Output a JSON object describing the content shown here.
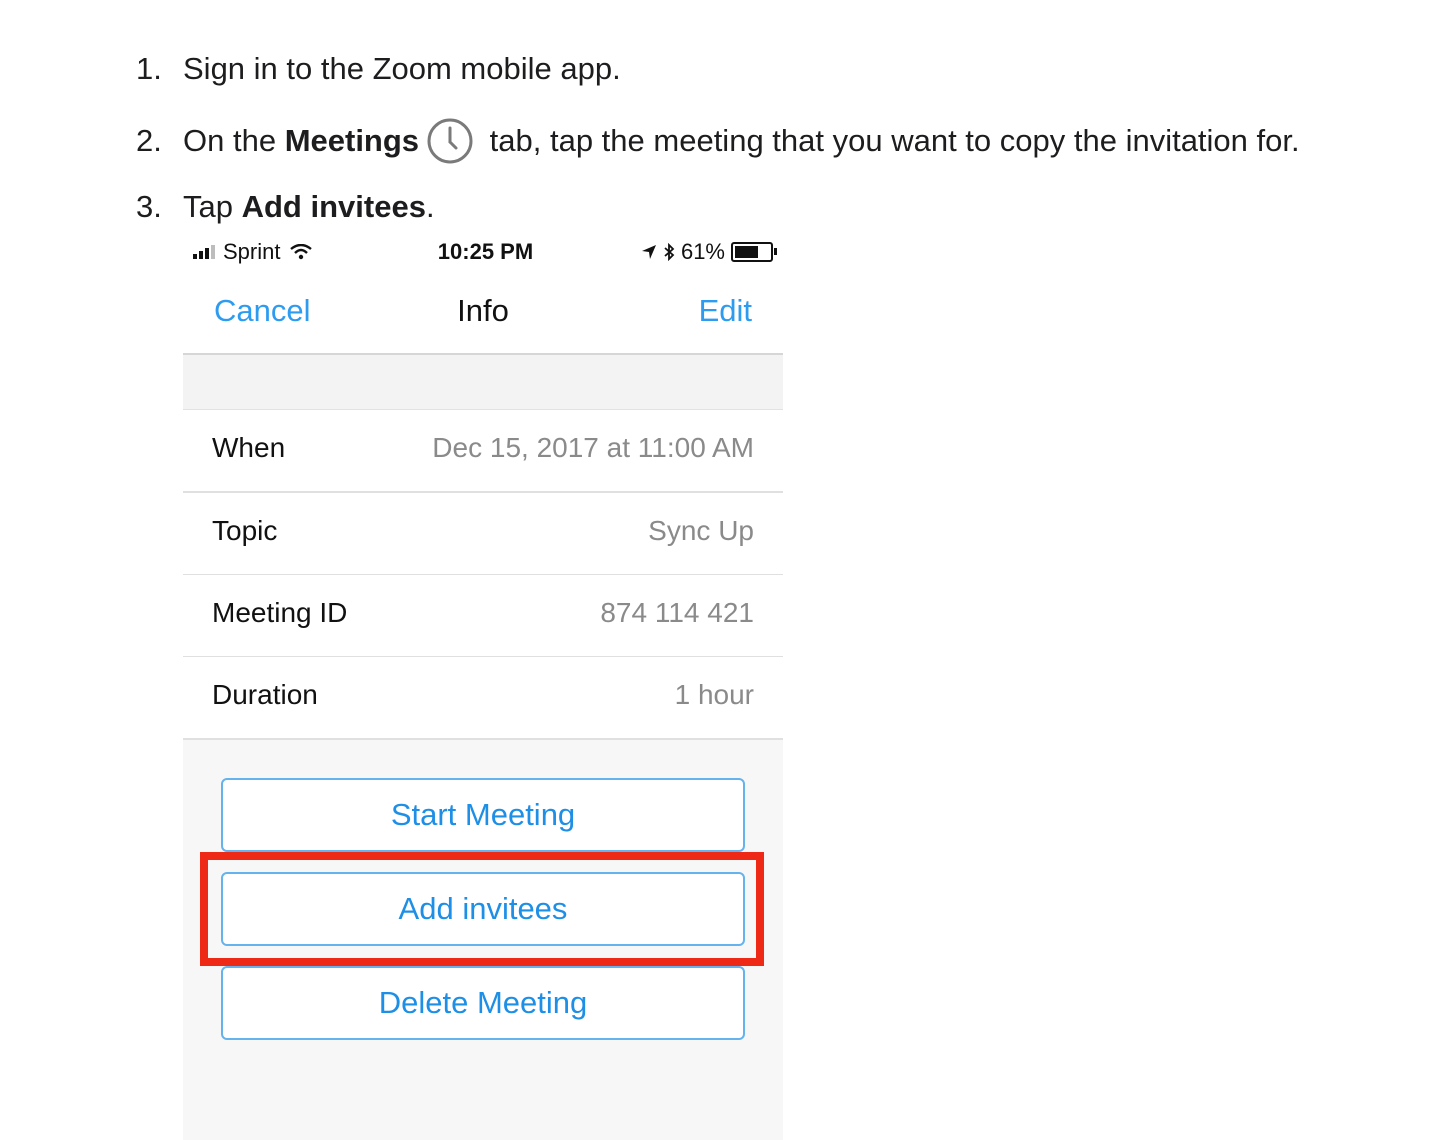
{
  "steps": [
    {
      "num": "1.",
      "text": "Sign in to the Zoom mobile app."
    },
    {
      "num": "2.",
      "pre": "On the ",
      "bold": "Meetings",
      "icon": "clock-icon",
      "post": " tab, tap the meeting that you want to copy the invitation for."
    },
    {
      "num": "3.",
      "pre": "Tap ",
      "bold": "Add invitees",
      "post": "."
    }
  ],
  "phone": {
    "status": {
      "carrier": "Sprint",
      "time": "10:25 PM",
      "battery": "61%"
    },
    "nav": {
      "cancel": "Cancel",
      "title": "Info",
      "edit": "Edit"
    },
    "rows": [
      {
        "label": "When",
        "value": "Dec 15, 2017 at 11:00 AM"
      },
      {
        "label": "Topic",
        "value": "Sync Up"
      },
      {
        "label": "Meeting ID",
        "value": "874 114 421"
      },
      {
        "label": "Duration",
        "value": "1 hour"
      }
    ],
    "buttons": {
      "start": "Start Meeting",
      "add": "Add invitees",
      "delete": "Delete Meeting"
    }
  },
  "colors": {
    "accent": "#2d9cf0",
    "highlight": "#ee2a17"
  }
}
